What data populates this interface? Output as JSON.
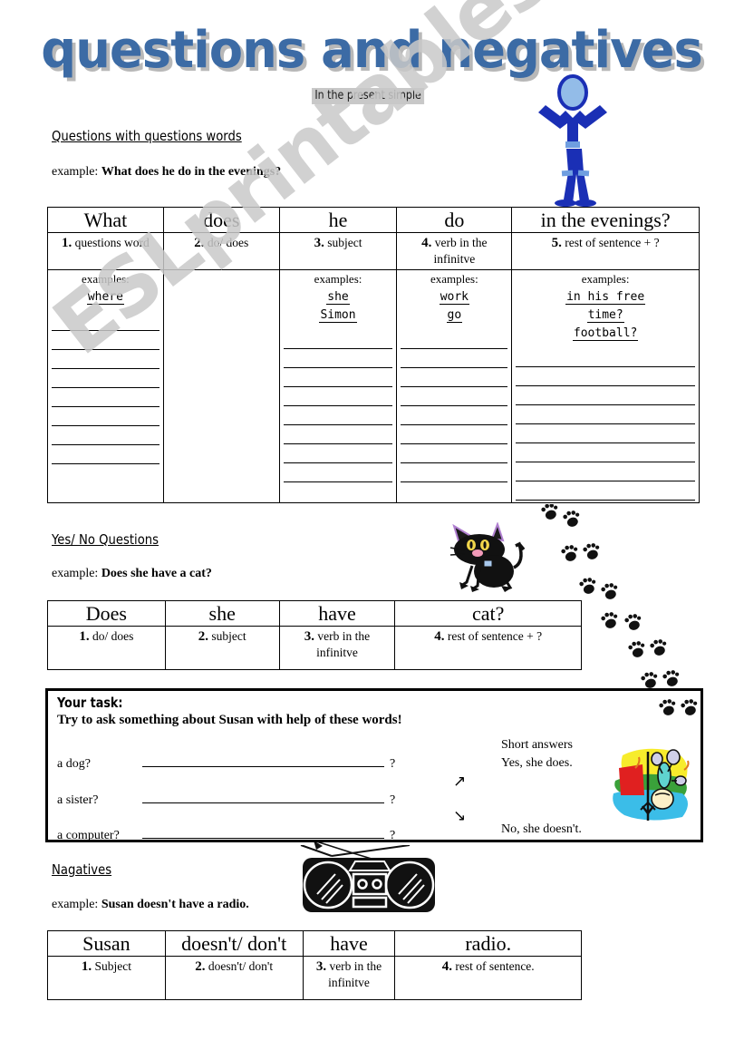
{
  "title": {
    "main": "questions and negatives",
    "subtitle": "In the present simple",
    "color": "#3c6ba5",
    "shadow_color": "#b8b8b8"
  },
  "watermark": {
    "text": "ESLprintables.com",
    "color": "#c9c9c9"
  },
  "sections": {
    "wh_questions": {
      "heading": "Questions with questions words",
      "example_label": "example:",
      "example_sentence": "What does he do in the evenings?",
      "headers": [
        "What",
        "does",
        "he",
        "do",
        "in the evenings?"
      ],
      "descriptions": [
        {
          "num": "1.",
          "text": "questions word"
        },
        {
          "num": "2.",
          "text": "do/ does"
        },
        {
          "num": "3.",
          "text": "subject"
        },
        {
          "num": "4.",
          "text": "verb in the infinitve"
        },
        {
          "num": "5.",
          "text": "rest of sentence + ?"
        }
      ],
      "examples_label": "examples:",
      "example_words": [
        [
          "where"
        ],
        [],
        [
          "she",
          "Simon"
        ],
        [
          "work",
          "go"
        ],
        [
          "in his free",
          "time?",
          "football?"
        ]
      ],
      "blank_line_counts": [
        8,
        0,
        8,
        8,
        8
      ]
    },
    "yes_no": {
      "heading": "Yes/ No Questions",
      "example_label": "example:",
      "example_sentence": "Does she have a cat?",
      "headers": [
        "Does",
        "she",
        "have",
        "cat?"
      ],
      "descriptions": [
        {
          "num": "1.",
          "text": "do/ does"
        },
        {
          "num": "2.",
          "text": "subject"
        },
        {
          "num": "3.",
          "text": "verb in the infinitve"
        },
        {
          "num": "4.",
          "text": "rest of sentence + ?"
        }
      ]
    },
    "task": {
      "title": "Your task:",
      "instruction": "Try to ask something about Susan with help of these words!",
      "prompts": [
        "a dog?",
        "a sister?",
        "a computer?"
      ],
      "question_mark": "?",
      "short_answers_label": "Short answers",
      "answer_yes": "Yes, she does.",
      "answer_no": "No, she doesn't.",
      "arrow_up": "↗",
      "arrow_down": "↘"
    },
    "negatives": {
      "heading": "Nagatives",
      "example_label": "example:",
      "example_sentence": "Susan doesn't have a radio.",
      "headers": [
        "Susan",
        "doesn't/ don't",
        "have",
        "radio."
      ],
      "descriptions": [
        {
          "num": "1.",
          "text": "Subject"
        },
        {
          "num": "2.",
          "text": "doesn't/ don't"
        },
        {
          "num": "3.",
          "text": "verb in the infinitve"
        },
        {
          "num": "4.",
          "text": "rest of sentence."
        }
      ]
    }
  },
  "clipart": {
    "stickman": "blue-stick-figure",
    "cat": "black-cat",
    "paw_prints": "cat-paw-prints",
    "radio": "boombox-radio",
    "flower": "colorful-garden-clipart"
  }
}
